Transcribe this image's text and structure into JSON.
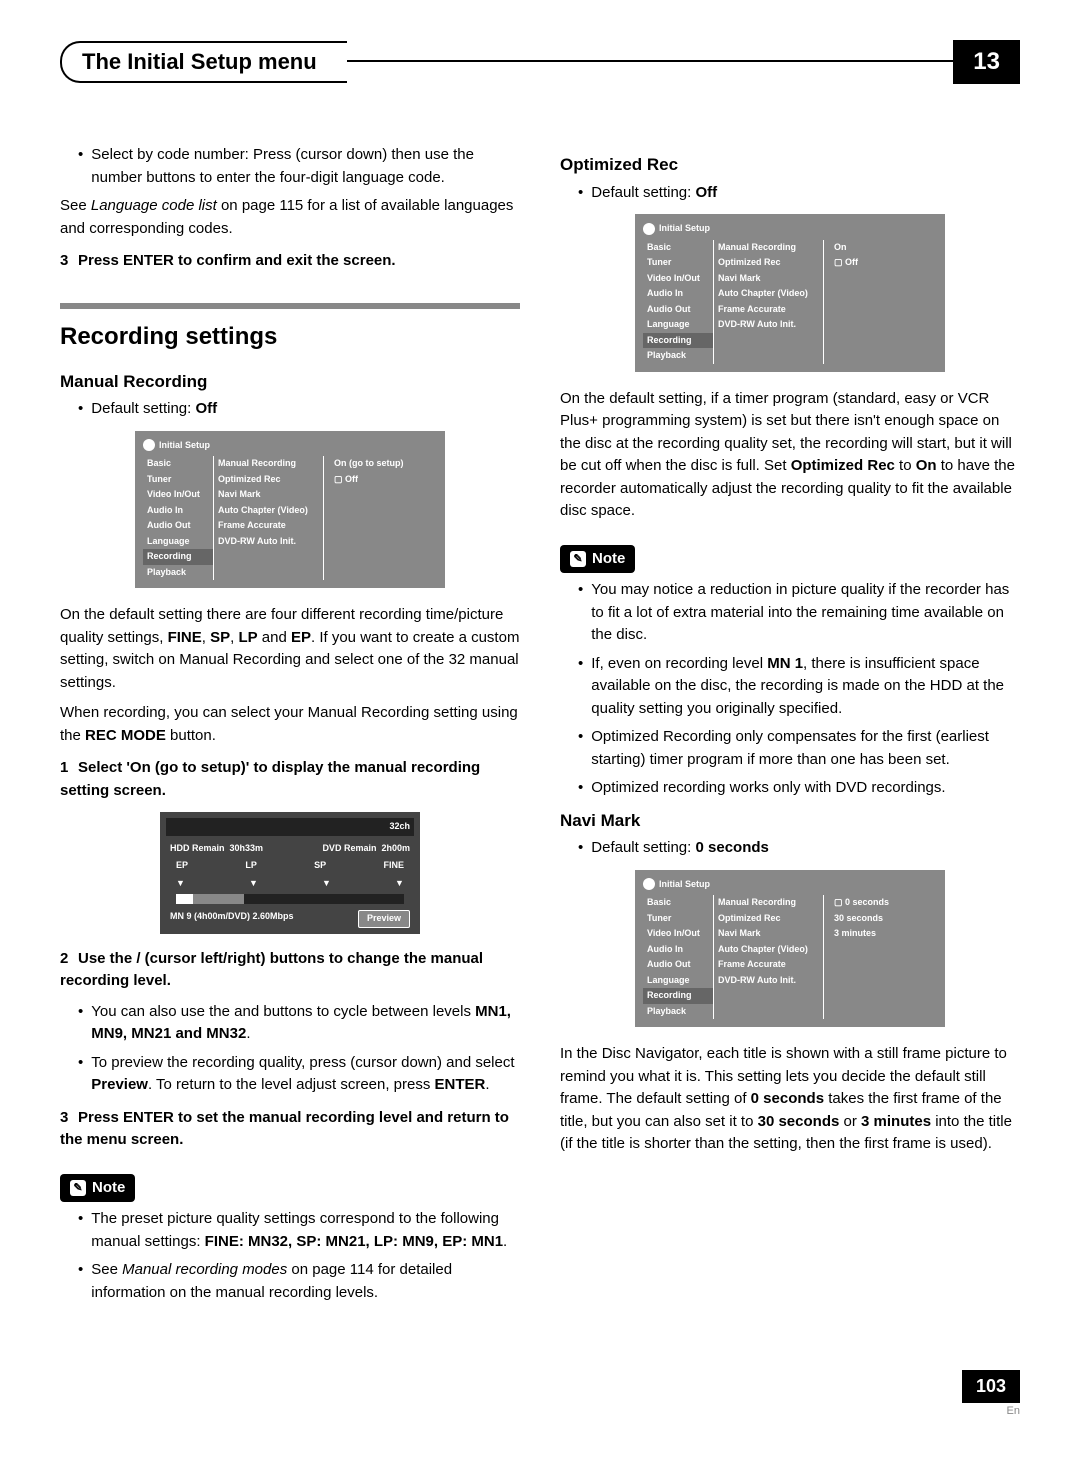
{
  "header": {
    "title": "The Initial Setup menu",
    "chapter": "13"
  },
  "left": {
    "intro_bullet": "Select by code number: Press     (cursor down) then use the number buttons to enter the four-digit language code.",
    "see_lang": "See Language code list on page 115 for a list of available languages and corresponding codes.",
    "step3a": "Press ENTER to confirm and exit the screen.",
    "h2": "Recording settings",
    "manual_h3": "Manual Recording",
    "manual_default": "Default setting: Off",
    "shot1": {
      "title": "Initial Setup",
      "left": [
        "Basic",
        "Tuner",
        "Video In/Out",
        "Audio In",
        "Audio Out",
        "Language",
        "Recording",
        "Playback"
      ],
      "mid": [
        "Manual Recording",
        "Optimized Rec",
        "Navi Mark",
        "Auto Chapter (Video)",
        "Frame Accurate",
        "DVD-RW Auto Init."
      ],
      "right": [
        "On (go to setup)",
        "Off"
      ]
    },
    "manual_p1a": "On the default setting there are four different recording time/picture quality settings, ",
    "manual_p1_fine": "FINE",
    "manual_p1_sp": "SP",
    "manual_p1_lp": "LP",
    "manual_p1_ep": "EP",
    "manual_p1b": ". If you want to create a custom setting, switch on Manual Recording and select one of the 32 manual settings.",
    "manual_p2a": "When recording, you can select your Manual Recording setting using the ",
    "manual_p2_btn": "REC MODE",
    "manual_p2b": " button.",
    "step1": "Select 'On (go to setup)' to display the manual recording setting screen.",
    "rec": {
      "ch": "32ch",
      "hdd_label": "HDD Remain",
      "hdd_val": "30h33m",
      "dvd_label": "DVD Remain",
      "dvd_val": "2h00m",
      "scale": [
        "EP",
        "LP",
        "SP",
        "FINE"
      ],
      "bottom_left": "MN 9 (4h00m/DVD)  2.60Mbps",
      "preview": "Preview"
    },
    "step2": "Use the   /     (cursor left/right) buttons to change the manual recording level.",
    "s2_b1a": "You can also use the         and         buttons to cycle between levels ",
    "s2_b1_vals": "MN1, MN9, MN21 and MN32",
    "s2_b2a": "To preview the recording quality, press     (cursor down) and select ",
    "s2_b2_prev": "Preview",
    "s2_b2b": ". To return to the level adjust screen, press ",
    "s2_b2_enter": "ENTER",
    "step3b": "Press ENTER to set the manual recording level and return to the menu screen.",
    "note_label": "Note",
    "note1a": "The preset picture quality settings correspond to the following manual settings: ",
    "note1b": "FINE: MN32, SP: MN21, LP: MN9, EP: MN1",
    "note2a": "See ",
    "note2_i": "Manual recording modes",
    "note2b": " on page 114 for detailed information on the manual recording levels."
  },
  "right": {
    "opt_h3": "Optimized Rec",
    "opt_default": "Default setting: Off",
    "shot2": {
      "title": "Initial Setup",
      "left": [
        "Basic",
        "Tuner",
        "Video In/Out",
        "Audio In",
        "Audio Out",
        "Language",
        "Recording",
        "Playback"
      ],
      "mid": [
        "Manual Recording",
        "Optimized Rec",
        "Navi Mark",
        "Auto Chapter (Video)",
        "Frame Accurate",
        "DVD-RW Auto Init."
      ],
      "right": [
        "On",
        "Off"
      ]
    },
    "opt_p_a": "On the default setting, if a timer program (standard, easy or VCR Plus+ programming system) is set but there isn't enough space on the disc at the recording quality set, the recording will start, but it will be cut off when the disc is full. Set ",
    "opt_p_b": "Optimized Rec",
    "opt_p_c": " to ",
    "opt_p_d": "On",
    "opt_p_e": " to have the recorder automatically adjust the recording quality to fit the available disc space.",
    "note_label": "Note",
    "on1": "You may notice a reduction in picture quality if the recorder has to fit a lot of extra material into the remaining time available on the disc.",
    "on2a": "If, even on recording level ",
    "on2_mn": "MN 1",
    "on2b": ", there is insufficient space available on the disc, the recording is made on the HDD at the quality setting you originally specified.",
    "on3": "Optimized Recording only compensates for the first (earliest starting) timer program if more than one has been set.",
    "on4": "Optimized recording works only with DVD recordings.",
    "navi_h3": "Navi Mark",
    "navi_default": "Default setting: 0 seconds",
    "shot3": {
      "title": "Initial Setup",
      "left": [
        "Basic",
        "Tuner",
        "Video In/Out",
        "Audio In",
        "Audio Out",
        "Language",
        "Recording",
        "Playback"
      ],
      "mid": [
        "Manual Recording",
        "Optimized Rec",
        "Navi Mark",
        "Auto Chapter (Video)",
        "Frame Accurate",
        "DVD-RW Auto Init."
      ],
      "right": [
        "0 seconds",
        "30 seconds",
        "3 minutes"
      ]
    },
    "navi_p_a": "In the Disc Navigator, each title is shown with a still frame picture to remind you what it is. This setting lets you decide the default still frame. The default setting of ",
    "navi_p_b": "0 seconds",
    "navi_p_c": " takes the first frame of the title, but you can also set it to ",
    "navi_p_d": "30 seconds",
    "navi_p_e": " or ",
    "navi_p_f": "3 minutes",
    "navi_p_g": " into the title (if the title is shorter than the setting, then the first frame is used)."
  },
  "footer": {
    "page": "103",
    "lang": "En"
  }
}
